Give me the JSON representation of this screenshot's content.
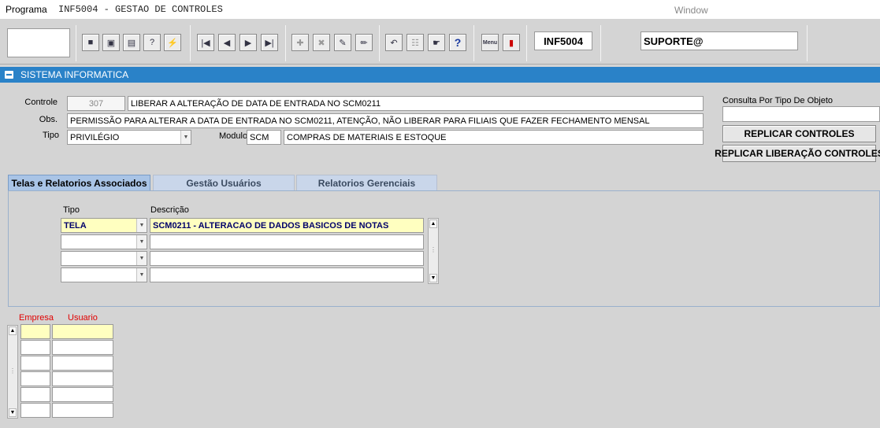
{
  "menubar": {
    "menu_programa": "Programa",
    "title": "INF5004 - GESTAO DE CONTROLES",
    "window_menu": "Window"
  },
  "toolbar": {
    "form_code": "INF5004",
    "user": "SUPORTE@",
    "menu_icon_text": "Menu"
  },
  "section": {
    "title": "SISTEMA INFORMATICA"
  },
  "form": {
    "controle_label": "Controle",
    "controle_code": "307",
    "controle_desc": "LIBERAR A ALTERAÇÃO DE DATA DE ENTRADA NO SCM0211",
    "obs_label": "Obs.",
    "obs_value": "PERMISSÃO PARA ALTERAR A DATA DE ENTRADA NO SCM0211, ATENÇÃO, NÃO LIBERAR PARA FILIAIS QUE FAZER FECHAMENTO MENSAL",
    "tipo_label": "Tipo",
    "tipo_value": "PRIVILÉGIO",
    "modulo_label": "Modulo",
    "modulo_code": "SCM",
    "modulo_desc": "COMPRAS DE MATERIAIS E ESTOQUE"
  },
  "side": {
    "consulta_label": "Consulta Por Tipo De Objeto",
    "consulta_value": "",
    "replicar_controles": "REPLICAR CONTROLES",
    "replicar_liberacao": "REPLICAR LIBERAÇÃO CONTROLES"
  },
  "tabs": [
    {
      "label": "Telas e Relatorios Associados"
    },
    {
      "label": "Gestão Usuários"
    },
    {
      "label": "Relatorios Gerenciais"
    }
  ],
  "associados": {
    "col_tipo": "Tipo",
    "col_descricao": "Descrição",
    "rows": [
      {
        "tipo": "TELA",
        "descricao": "SCM0211 - ALTERACAO DE DADOS BASICOS DE NOTAS"
      },
      {
        "tipo": "",
        "descricao": ""
      },
      {
        "tipo": "",
        "descricao": ""
      },
      {
        "tipo": "",
        "descricao": ""
      }
    ]
  },
  "usuarios": {
    "col_empresa": "Empresa",
    "col_usuario": "Usuario",
    "rows": [
      {
        "empresa": "",
        "usuario": ""
      },
      {
        "empresa": "",
        "usuario": ""
      },
      {
        "empresa": "",
        "usuario": ""
      },
      {
        "empresa": "",
        "usuario": ""
      },
      {
        "empresa": "",
        "usuario": ""
      },
      {
        "empresa": "",
        "usuario": ""
      }
    ]
  },
  "colors": {
    "section_bar": "#2a82c8",
    "highlight_row": "#ffffc0",
    "label_red": "#e00000"
  }
}
